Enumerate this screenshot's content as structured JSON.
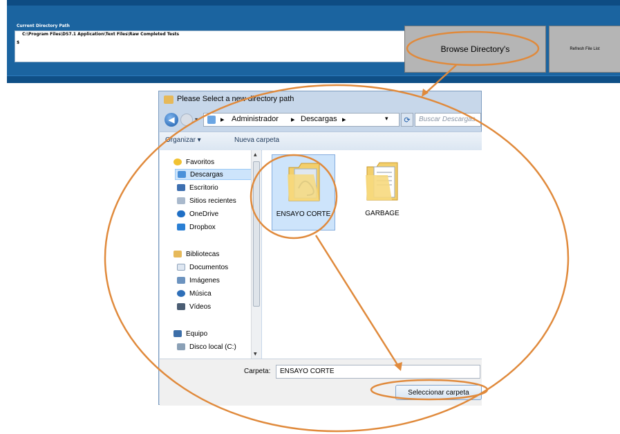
{
  "app": {
    "title_fragment": "",
    "current_dir_label": "Current Directory Path",
    "current_dir_value": "C:\\Program Files\\DS7.1 Application\\Text Files\\Raw Completed Tests",
    "caret": "$",
    "browse_button": "Browse Directory's",
    "refresh_button": "Refresh File List"
  },
  "dialog": {
    "title": "Please Select a new directory path",
    "breadcrumb": [
      "Administrador",
      "Descargas"
    ],
    "search_placeholder": "Buscar Descargas",
    "toolbar": {
      "organize": "Organizar ▾",
      "new_folder": "Nueva carpeta"
    },
    "nav_items": [
      {
        "label": "Favoritos",
        "icon": "star-icon",
        "group": true
      },
      {
        "label": "Descargas",
        "icon": "downloads-folder-icon",
        "selected": true
      },
      {
        "label": "Escritorio",
        "icon": "desktop-icon"
      },
      {
        "label": "Sitios recientes",
        "icon": "recent-places-icon"
      },
      {
        "label": "OneDrive",
        "icon": "onedrive-icon"
      },
      {
        "label": "Dropbox",
        "icon": "dropbox-icon"
      },
      {
        "label": "Bibliotecas",
        "icon": "libraries-icon",
        "group": true
      },
      {
        "label": "Documentos",
        "icon": "documents-icon"
      },
      {
        "label": "Imágenes",
        "icon": "pictures-icon"
      },
      {
        "label": "Música",
        "icon": "music-icon"
      },
      {
        "label": "Vídeos",
        "icon": "videos-icon"
      },
      {
        "label": "Equipo",
        "icon": "computer-icon",
        "group": true
      },
      {
        "label": "Disco local (C:)",
        "icon": "disk-icon"
      }
    ],
    "folders": [
      {
        "label": "ENSAYO CORTE",
        "selected": true
      },
      {
        "label": "GARBAGE",
        "selected": false
      }
    ],
    "folder_name_label": "Carpeta:",
    "folder_name_value": "ENSAYO CORTE",
    "select_button": "Seleccionar carpeta"
  },
  "colors": {
    "app_blue": "#1b64a0",
    "highlight": "#cde4fb",
    "annotation_orange": "#e08a3c"
  }
}
